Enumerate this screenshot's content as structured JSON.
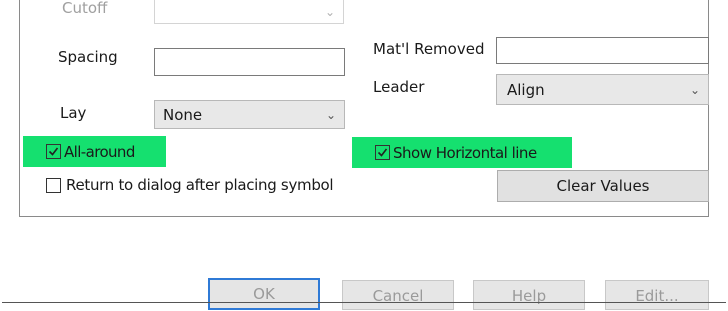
{
  "fields": {
    "cutoff_label": "Cutoff",
    "cutoff_value": "",
    "spacing_label": "Spacing",
    "spacing_value": "",
    "lay_label": "Lay",
    "lay_value": "None",
    "matl_removed_label": "Mat'l Removed",
    "matl_removed_value": "",
    "leader_label": "Leader",
    "leader_value": "Align"
  },
  "checkboxes": {
    "all_around": {
      "label": "All-around",
      "checked": true
    },
    "show_horizontal_line": {
      "label": "Show Horizontal line",
      "checked": true
    },
    "return_to_dialog": {
      "label": "Return to dialog after placing symbol",
      "checked": false
    }
  },
  "buttons": {
    "clear_values": "Clear Values",
    "ok": "OK",
    "cancel": "Cancel",
    "help": "Help",
    "edit": "Edit..."
  },
  "colors": {
    "highlight": "#15e06f",
    "default_button_border": "#2f7ad6"
  },
  "icons": {
    "dropdown": "chevron-down-icon",
    "check": "checkmark-icon"
  }
}
